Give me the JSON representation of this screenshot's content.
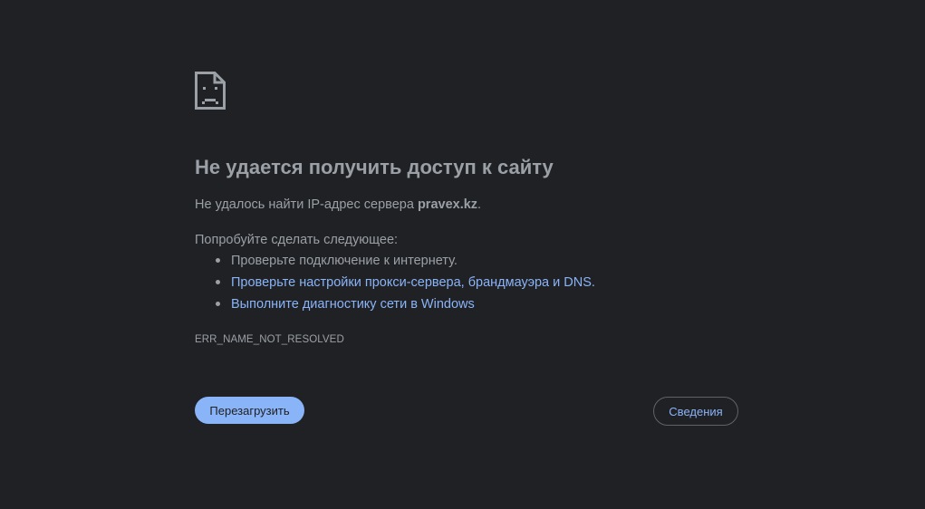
{
  "error": {
    "icon": "sad-page-icon",
    "title": "Не удается получить доступ к сайту",
    "message_prefix": "Не удалось найти IP-адрес сервера",
    "host": "pravex.kz",
    "message_suffix": ".",
    "try_label": "Попробуйте сделать следующее:",
    "suggestions": [
      {
        "text": "Проверьте подключение к интернету.",
        "link": false
      },
      {
        "text": "Проверьте настройки прокси-сервера, брандмауэра и DNS.",
        "link": true
      },
      {
        "text": "Выполните диагностику сети в Windows",
        "link": true
      }
    ],
    "code": "ERR_NAME_NOT_RESOLVED"
  },
  "buttons": {
    "reload_label": "Перезагрузить",
    "details_label": "Сведения"
  },
  "colors": {
    "background": "#202124",
    "text": "#9aa0a6",
    "link": "#8ab4f8",
    "primary_button": "#8ab4f8"
  }
}
